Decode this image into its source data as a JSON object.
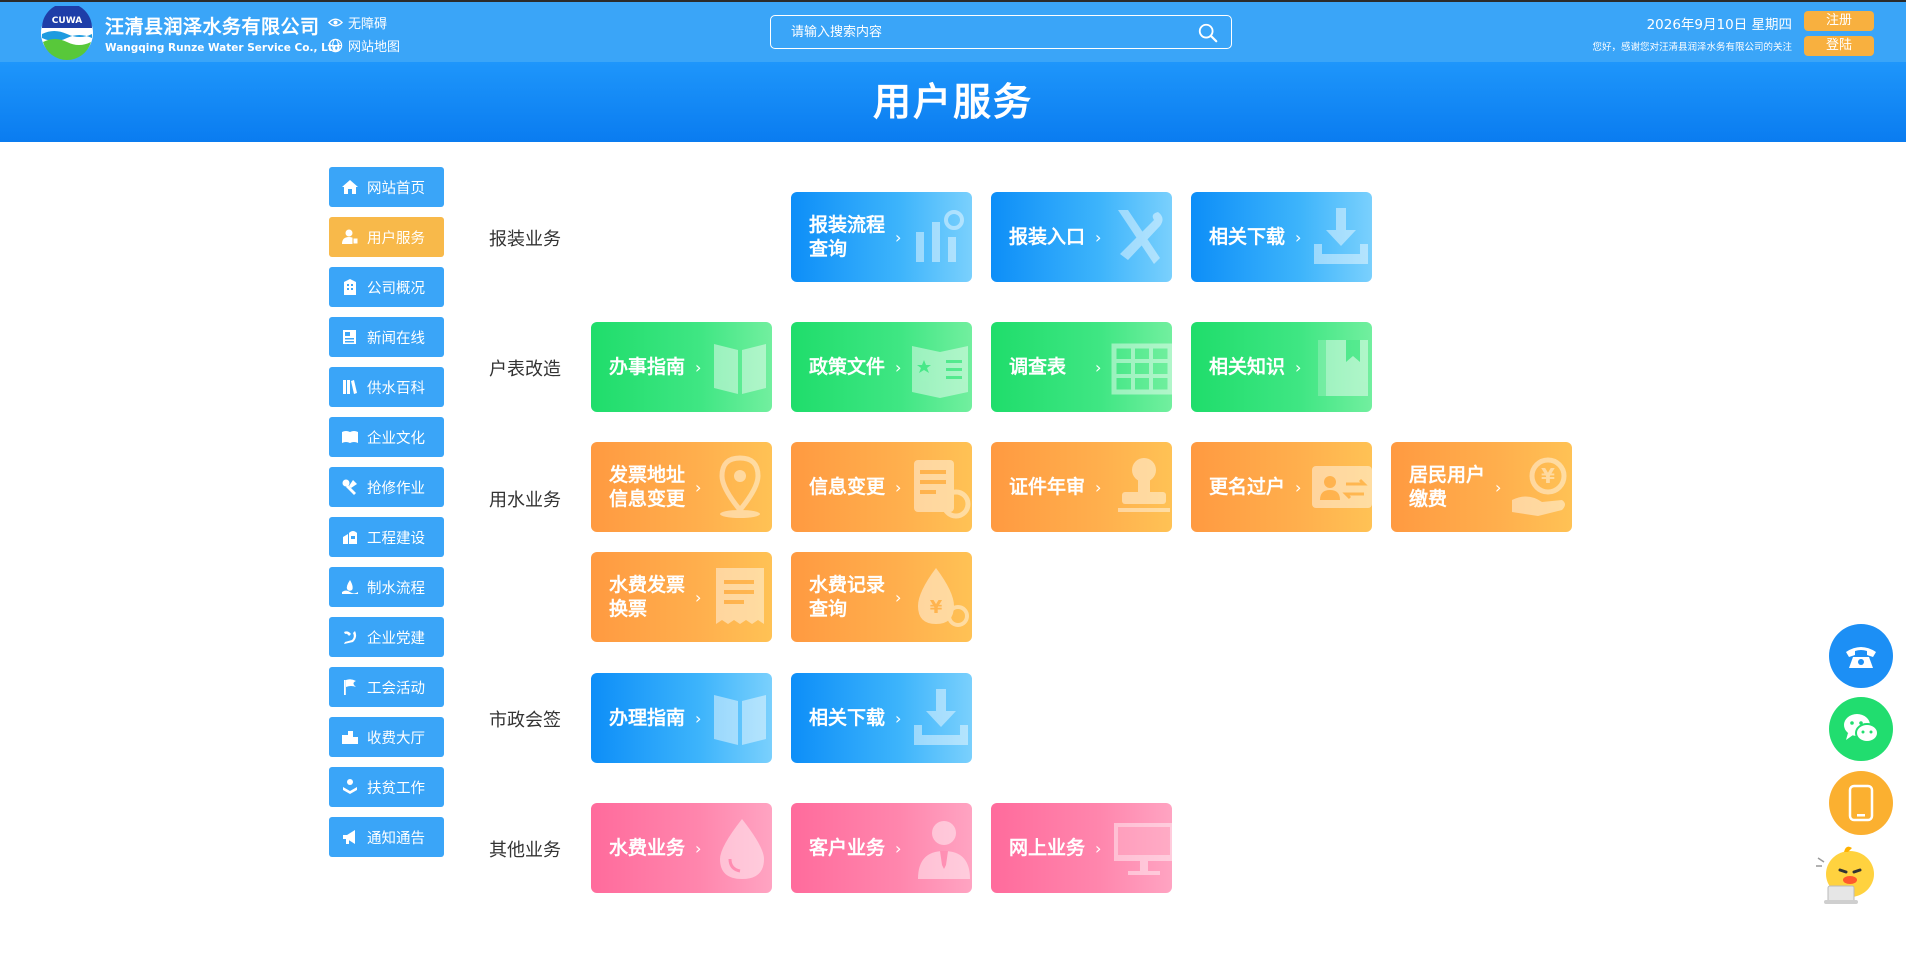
{
  "header": {
    "company_cn": "汪清县润泽水务有限公司",
    "company_en": "Wangqing Runze Water Service Co., Ltd",
    "logo_text": "CUWA",
    "accessibility": "无障碍",
    "sitemap": "网站地图",
    "search_placeholder": "请输入搜索内容",
    "date": "2026年9月10日 星期四",
    "welcome": "您好，感谢您对汪清县润泽水务有限公司的关注",
    "register": "注册",
    "login": "登陆"
  },
  "banner": {
    "title": "用户服务"
  },
  "sidebar": {
    "items": [
      {
        "label": "网站首页",
        "icon": "home-icon"
      },
      {
        "label": "用户服务",
        "icon": "user-icon",
        "active": true
      },
      {
        "label": "公司概况",
        "icon": "building-icon"
      },
      {
        "label": "新闻在线",
        "icon": "news-icon"
      },
      {
        "label": "供水百科",
        "icon": "books-icon"
      },
      {
        "label": "企业文化",
        "icon": "open-book-icon"
      },
      {
        "label": "抢修作业",
        "icon": "repair-icon"
      },
      {
        "label": "工程建设",
        "icon": "construction-icon"
      },
      {
        "label": "制水流程",
        "icon": "water-process-icon"
      },
      {
        "label": "企业党建",
        "icon": "party-icon"
      },
      {
        "label": "工会活动",
        "icon": "flag-icon"
      },
      {
        "label": "收费大厅",
        "icon": "hall-icon"
      },
      {
        "label": "扶贫工作",
        "icon": "help-icon"
      },
      {
        "label": "通知通告",
        "icon": "megaphone-icon"
      }
    ]
  },
  "sections": {
    "baozhuang": {
      "label": "报装业务",
      "cards": [
        {
          "label": "报装流程查询",
          "icon": "flow-chart-icon"
        },
        {
          "label": "报装入口",
          "icon": "tools-icon"
        },
        {
          "label": "相关下载",
          "icon": "download-icon"
        }
      ]
    },
    "hubiao": {
      "label": "户表改造",
      "cards": [
        {
          "label": "办事指南",
          "icon": "guide-book-icon"
        },
        {
          "label": "政策文件",
          "icon": "policy-doc-icon"
        },
        {
          "label": "调查表",
          "icon": "table-icon"
        },
        {
          "label": "相关知识",
          "icon": "knowledge-book-icon"
        }
      ]
    },
    "yongshui": {
      "label": "用水业务",
      "cards": [
        {
          "label": "发票地址信息变更",
          "icon": "location-pin-icon"
        },
        {
          "label": "信息变更",
          "icon": "doc-refresh-icon"
        },
        {
          "label": "证件年审",
          "icon": "stamp-icon"
        },
        {
          "label": "更名过户",
          "icon": "id-card-icon"
        },
        {
          "label": "居民用户缴费",
          "icon": "yuan-hand-icon"
        },
        {
          "label": "水费发票换票",
          "icon": "receipt-icon"
        },
        {
          "label": "水费记录查询",
          "icon": "yuan-drop-icon"
        }
      ]
    },
    "shizheng": {
      "label": "市政会签",
      "cards": [
        {
          "label": "办理指南",
          "icon": "guide-book-icon"
        },
        {
          "label": "相关下载",
          "icon": "download-icon"
        }
      ]
    },
    "qita": {
      "label": "其他业务",
      "cards": [
        {
          "label": "水费业务",
          "icon": "water-drop-icon"
        },
        {
          "label": "客户业务",
          "icon": "customer-icon"
        },
        {
          "label": "网上业务",
          "icon": "monitor-icon"
        }
      ]
    }
  },
  "floating": [
    {
      "name": "phone",
      "icon": "phone-icon",
      "color": "#1c8ff5"
    },
    {
      "name": "wechat",
      "icon": "wechat-icon",
      "color": "#21dd6f"
    },
    {
      "name": "mobile",
      "icon": "mobile-icon",
      "color": "#fbb030"
    }
  ],
  "chevron": "›"
}
